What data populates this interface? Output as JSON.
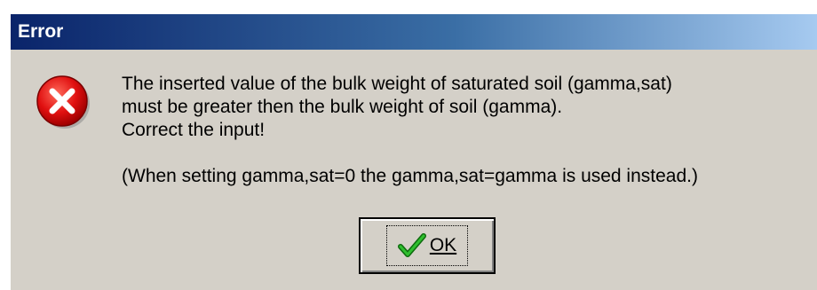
{
  "window": {
    "title": "Error"
  },
  "dialog": {
    "icon": "error-x-icon",
    "message_lines": [
      "The inserted value of the bulk weight of saturated soil (gamma,sat)",
      "must be greater then the bulk weight of soil (gamma).",
      "Correct the input!"
    ],
    "note": "(When setting gamma,sat=0 the gamma,sat=gamma is used instead.)"
  },
  "buttons": {
    "ok": {
      "label": "OK",
      "icon": "checkmark-icon"
    }
  },
  "colors": {
    "titlebar_start": "#0a246a",
    "titlebar_end": "#a6caf0",
    "dialog_face": "#d4d0c8",
    "error_red": "#e01010",
    "check_green": "#1a9a1a"
  }
}
